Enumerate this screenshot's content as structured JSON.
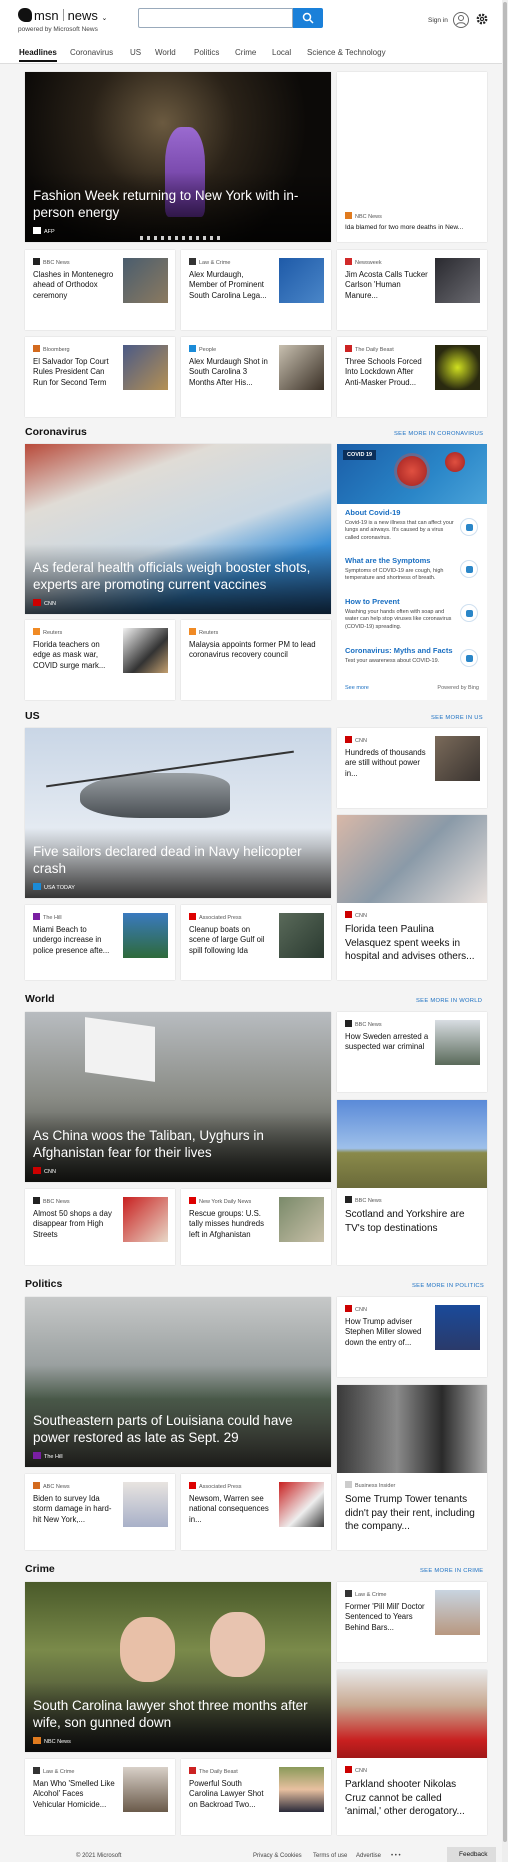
{
  "header": {
    "brand": "msn",
    "product": "news",
    "powered": "powered by Microsoft News",
    "search_placeholder": "",
    "signin": "Sign in",
    "icons": [
      "search-icon",
      "avatar-icon",
      "gear-icon"
    ]
  },
  "nav": [
    "Headlines",
    "Coronavirus",
    "US",
    "World",
    "Politics",
    "Crime",
    "Local",
    "Science & Technology"
  ],
  "headlines": {
    "hero": {
      "title": "Fashion Week returning to New York with in-person energy",
      "source": "AFP"
    },
    "side": {
      "source": "NBC News",
      "title": "Ida blamed for two more deaths in New..."
    },
    "cards": [
      {
        "source": "BBC News",
        "title": "Clashes in Montenegro ahead of Orthodox ceremony"
      },
      {
        "source": "Law & Crime",
        "title": "Alex Murdaugh, Member of Prominent South Carolina Lega..."
      },
      {
        "source": "Newsweek",
        "title": "Jim Acosta Calls Tucker Carlson 'Human Manure..."
      },
      {
        "source": "Bloomberg",
        "title": "El Salvador Top Court Rules President Can Run for Second Term"
      },
      {
        "source": "People",
        "title": "Alex Murdaugh Shot in South Carolina 3 Months After His..."
      },
      {
        "source": "The Daily Beast",
        "title": "Three Schools Forced Into Lockdown After Anti-Masker Proud..."
      }
    ]
  },
  "coronavirus": {
    "heading": "Coronavirus",
    "see_more": "SEE MORE IN CORONAVIRUS",
    "hero": {
      "title": "As federal health officials weigh booster shots, experts are promoting current vaccines",
      "source": "CNN"
    },
    "cards": [
      {
        "source": "Reuters",
        "title": "Florida teachers on edge as mask war, COVID surge mark..."
      },
      {
        "source": "Reuters",
        "title": "Malaysia appoints former PM to lead coronavirus recovery council"
      }
    ],
    "panel": {
      "badge": "COVID 19",
      "items": [
        {
          "title": "About Covid-19",
          "text": "Covid-19 is a new illness that can affect your lungs and airways. It's caused by a virus called coronavirus."
        },
        {
          "title": "What are the Symptoms",
          "text": "Symptoms of COVID-19 are cough, high temperature and shortness of breath."
        },
        {
          "title": "How to Prevent",
          "text": "Washing your hands often with soap and water can help stop viruses like coronavirus (COVID-19) spreading."
        },
        {
          "title": "Coronavirus: Myths and Facts",
          "text": "Test your awareness about COVID-19."
        }
      ],
      "see_more": "See more",
      "powered": "Powered by Bing"
    }
  },
  "us": {
    "heading": "US",
    "see_more": "SEE MORE IN US",
    "hero": {
      "title": "Five sailors declared dead in Navy helicopter crash",
      "source": "USA TODAY"
    },
    "side": {
      "source": "CNN",
      "title": "Hundreds of thousands are still without power in..."
    },
    "tall": {
      "source": "CNN",
      "title": "Florida teen Paulina Velasquez spent weeks in hospital and advises others..."
    },
    "cards": [
      {
        "source": "The Hill",
        "title": "Miami Beach to undergo increase in police presence afte..."
      },
      {
        "source": "Associated Press",
        "title": "Cleanup boats on scene of large Gulf oil spill following Ida"
      }
    ]
  },
  "world": {
    "heading": "World",
    "see_more": "SEE MORE IN WORLD",
    "hero": {
      "title": "As China woos the Taliban, Uyghurs in Afghanistan fear for their lives",
      "source": "CNN"
    },
    "side": {
      "source": "BBC News",
      "title": "How Sweden arrested a suspected war criminal"
    },
    "tall": {
      "source": "BBC News",
      "title": "Scotland and Yorkshire are TV's top destinations"
    },
    "cards": [
      {
        "source": "BBC News",
        "title": "Almost 50 shops a day disappear from High Streets"
      },
      {
        "source": "New York Daily News",
        "title": "Rescue groups: U.S. tally misses hundreds left in Afghanistan"
      }
    ]
  },
  "politics": {
    "heading": "Politics",
    "see_more": "SEE MORE IN POLITICS",
    "hero": {
      "title": "Southeastern parts of Louisiana could have power restored as late as Sept. 29",
      "source": "The Hill"
    },
    "side": {
      "source": "CNN",
      "title": "How Trump adviser Stephen Miller slowed down the entry of..."
    },
    "tall": {
      "source": "Business Insider",
      "title": "Some Trump Tower tenants didn't pay their rent, including the company..."
    },
    "cards": [
      {
        "source": "ABC News",
        "title": "Biden to survey Ida storm damage in hard-hit New York,..."
      },
      {
        "source": "Associated Press",
        "title": "Newsom, Warren see national consequences in..."
      }
    ]
  },
  "crime": {
    "heading": "Crime",
    "see_more": "SEE MORE IN CRIME",
    "hero": {
      "title": "South Carolina lawyer shot three months after wife, son gunned down",
      "source": "NBC News"
    },
    "side": {
      "source": "Law & Crime",
      "title": "Former 'Pill Mill' Doctor Sentenced to Years Behind Bars..."
    },
    "tall": {
      "source": "CNN",
      "title": "Parkland shooter Nikolas Cruz cannot be called 'animal,' other derogatory..."
    },
    "cards": [
      {
        "source": "Law & Crime",
        "title": "Man Who 'Smelled Like Alcohol' Faces Vehicular Homicide..."
      },
      {
        "source": "The Daily Beast",
        "title": "Powerful South Carolina Lawyer Shot on Backroad Two..."
      }
    ]
  },
  "footer": {
    "copyright": "© 2021 Microsoft",
    "links": [
      "Privacy & Cookies",
      "Terms of use",
      "Advertise"
    ],
    "more": "• • •",
    "feedback": "Feedback"
  }
}
